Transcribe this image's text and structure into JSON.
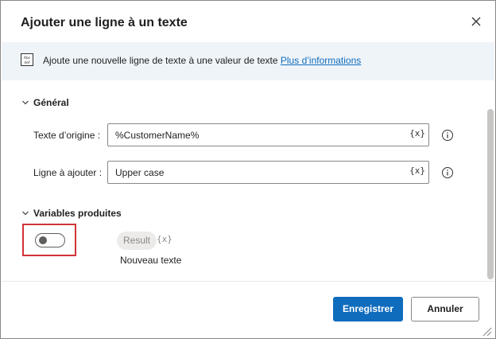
{
  "dialog": {
    "title": "Ajouter une ligne à un texte"
  },
  "info": {
    "text": "Ajoute une nouvelle ligne de texte à une valeur de texte ",
    "link": "Plus d’informations",
    "icon_text": "Abc def"
  },
  "general": {
    "header": "Général",
    "fields": [
      {
        "label": "Texte d’origine :",
        "value": "%CustomerName%",
        "var_button": "{x}"
      },
      {
        "label": "Ligne à ajouter :",
        "value": "Upper case",
        "var_button": "{x}"
      }
    ]
  },
  "variables": {
    "header": "Variables produites",
    "toggle_on": false,
    "variable_name": "Result",
    "variable_curly": "{x}",
    "variable_description": "Nouveau texte"
  },
  "buttons": {
    "save": "Enregistrer",
    "cancel": "Annuler"
  },
  "colors": {
    "accent": "#0f6cbd",
    "highlight": "#d13438",
    "info_background": "#eff4f9"
  }
}
